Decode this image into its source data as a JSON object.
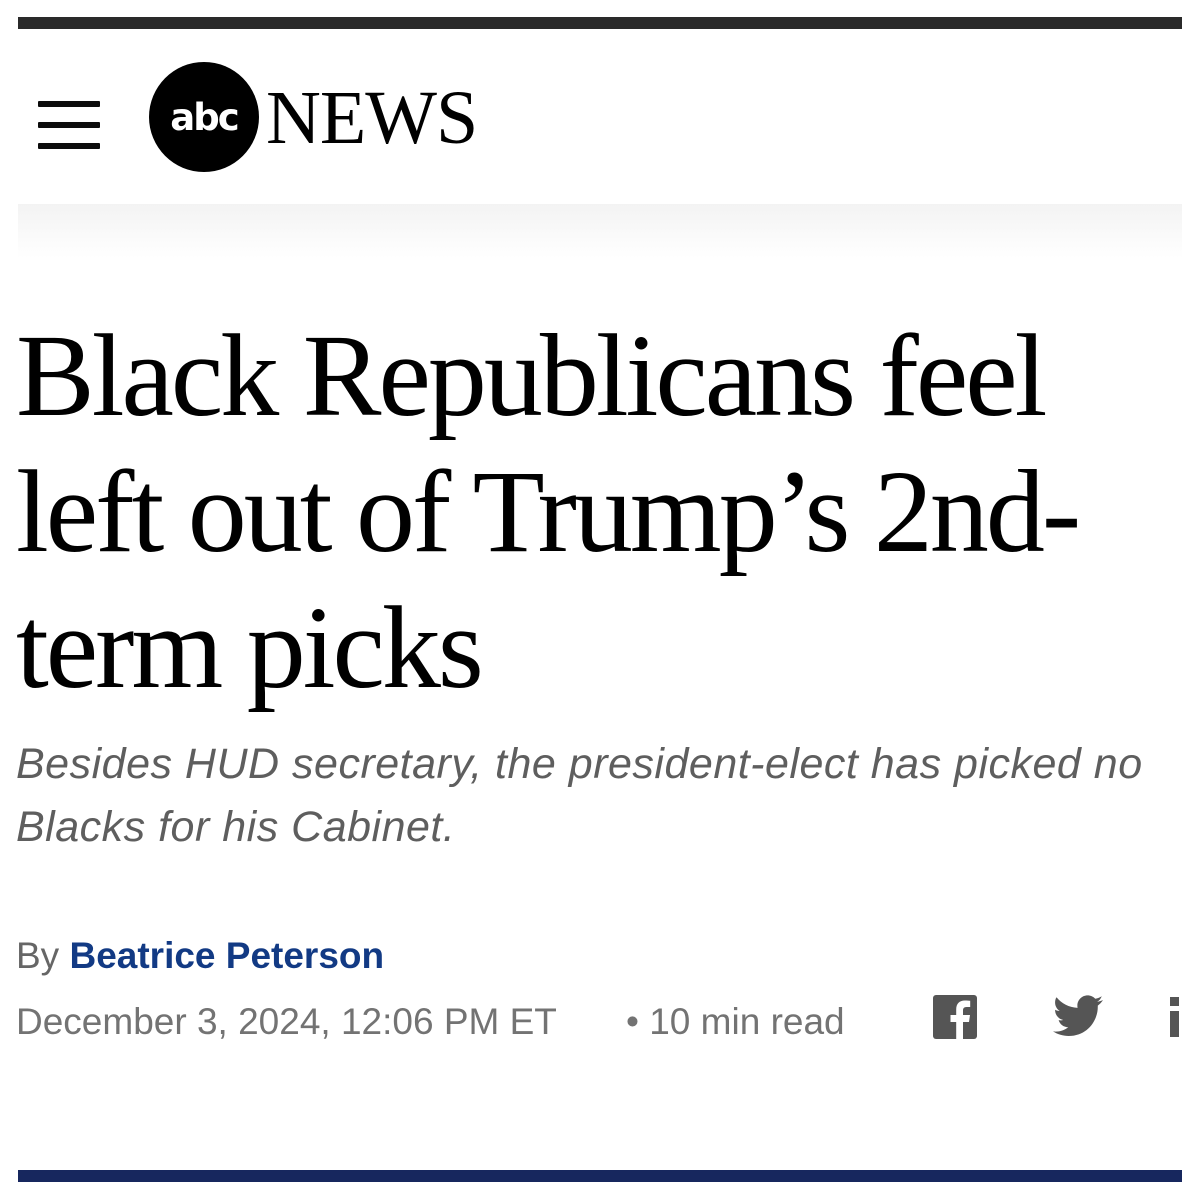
{
  "header": {
    "menu_icon": "hamburger-menu-icon",
    "logo_badge": "abc",
    "logo_wordmark": "NEWS"
  },
  "article": {
    "headline": "Black Republicans feel left out of Trump’s 2nd-term picks",
    "subheadline": "Besides HUD secretary, the president-elect has picked no Blacks for his Cabinet.",
    "byline_prefix": "By",
    "author": "Beatrice Peterson",
    "date": "December 3, 2024, 12:06 PM ET",
    "read_time": "• 10 min read"
  },
  "share": {
    "icons": [
      "facebook-icon",
      "twitter-icon",
      "more-share-icon"
    ]
  },
  "colors": {
    "author_link": "#123a84",
    "bottom_rule": "#17275e",
    "meta_text": "#737373",
    "share_icons": "#555555"
  }
}
